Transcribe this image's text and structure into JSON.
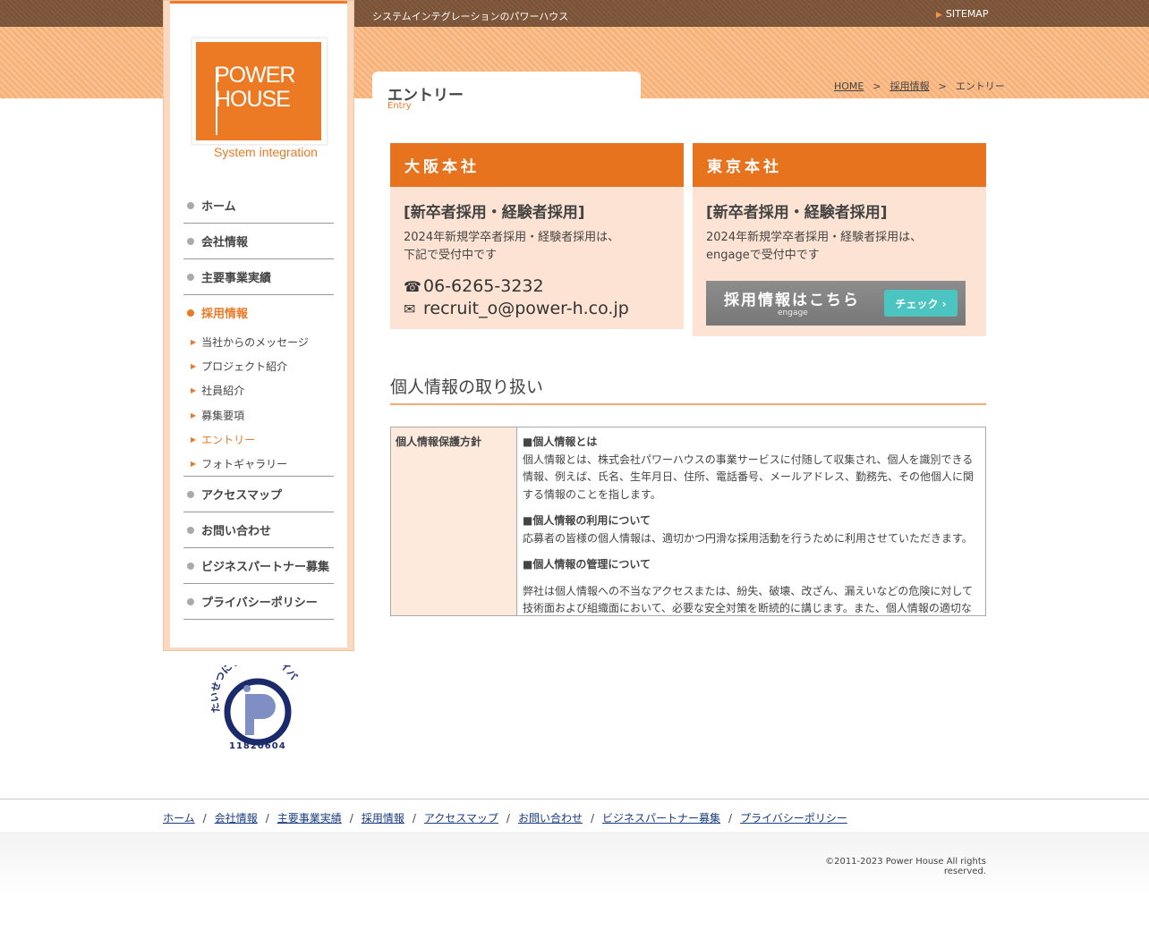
{
  "header": {
    "tagline": "システムインテグレーションのパワーハウス",
    "sitemap": "SITEMAP"
  },
  "logo": {
    "line1": "POWER",
    "line2": "HOUSE",
    "sub": "System integration"
  },
  "nav": {
    "items": [
      "ホーム",
      "会社情報",
      "主要事業実績",
      "採用情報"
    ],
    "sub_items": [
      "当社からのメッセージ",
      "プロジェクト紹介",
      "社員紹介",
      "募集要項",
      "エントリー",
      "フォトギャラリー"
    ],
    "items_after": [
      "アクセスマップ",
      "お問い合わせ",
      "ビジネスパートナー募集",
      "プライバシーポリシー"
    ],
    "active": "採用情報",
    "active_sub": "エントリー"
  },
  "pmark": {
    "text": "たいせつにしますプライバシー",
    "number": "11820604"
  },
  "page": {
    "title": "エントリー",
    "subtitle": "Entry"
  },
  "breadcrumb": {
    "home": "HOME",
    "sep": ">",
    "parent": "採用情報",
    "current": "エントリー"
  },
  "osaka": {
    "title": "大阪本社",
    "sub": "[新卒者採用・経験者採用]",
    "text1": "2024年新規学卒者採用・経験者採用は、",
    "text2": "下記で受付中です",
    "phone_icon": "☎",
    "phone": "06-6265-3232",
    "mail_icon": "✉",
    "email": "recruit_o@power-h.co.jp"
  },
  "tokyo": {
    "title": "東京本社",
    "sub": "[新卒者採用・経験者採用]",
    "text1": "2024年新規学卒者採用・経験者採用は、",
    "text2": "engageで受付中です",
    "banner_text": "採用情報はこちら",
    "banner_sub": "engage",
    "banner_btn": "チェック ›"
  },
  "privacy": {
    "section_title": "個人情報の取り扱い",
    "th": "個人情報保護方針",
    "h1": "■個人情報とは",
    "p1": "個人情報とは、株式会社パワーハウスの事業サービスに付随して収集され、個人を識別できる情報、例えば、氏名、生年月日、住所、電話番号、メールアドレス、勤務先、その他個人に関する情報のことを指します。",
    "h2": "■個人情報の利用について",
    "p2": "応募者の皆様の個人情報は、適切かつ円滑な採用活動を行うために利用させていただきます。",
    "h3": "■個人情報の管理について",
    "p3": "弊社は個人情報への不当なアクセスまたは、紛失、破壊、改ざん、漏えいなどの危険に対して技術面および組織面において、必要な安全対策を断続的に講じます。また、個人情報の適切な"
  },
  "footer": {
    "links": [
      "ホーム",
      "会社情報",
      "主要事業実績",
      "採用情報",
      "アクセスマップ",
      "お問い合わせ",
      "ビジネスパートナー募集",
      "プライバシーポリシー"
    ],
    "sep": "/",
    "copyright": "©2011-2023 Power House All rights reserved."
  },
  "colors": {
    "accent": "#e8731f",
    "brown": "#7a5236",
    "light": "#fde3d3"
  }
}
